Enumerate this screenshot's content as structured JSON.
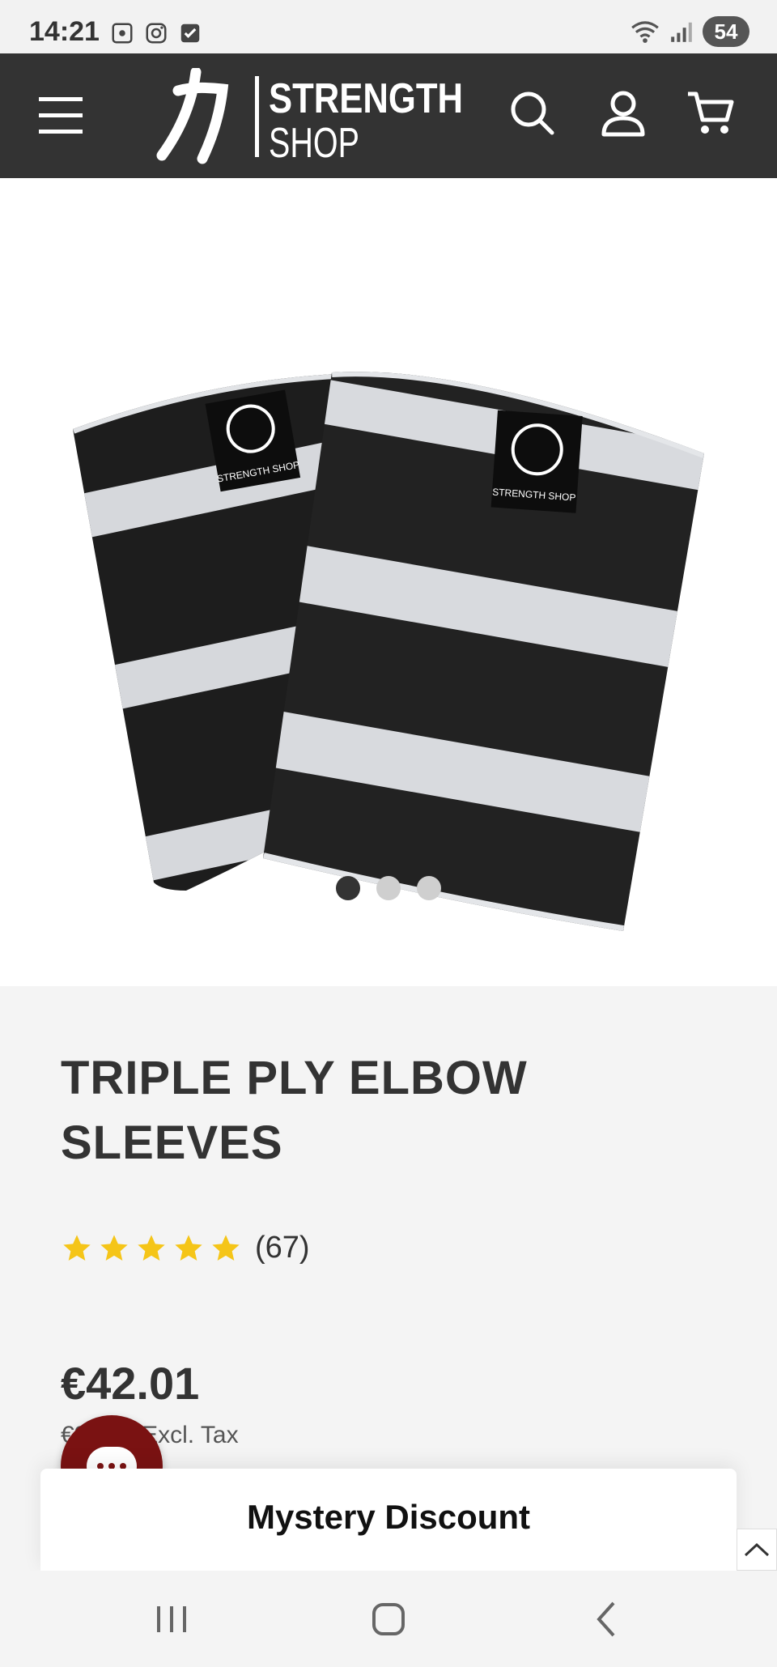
{
  "status_bar": {
    "time": "14:21",
    "battery": "54",
    "icons": [
      "screenshot-icon",
      "instagram-icon",
      "checkbox-icon",
      "wifi-icon",
      "signal-icon"
    ]
  },
  "header": {
    "brand_top": "STRENGTH",
    "brand_bottom": "SHOP",
    "icons": [
      "menu-icon",
      "search-icon",
      "account-icon",
      "cart-icon"
    ],
    "color": "#333333"
  },
  "gallery": {
    "image_alt": "Triple ply elbow sleeves product image",
    "label_text": "STRENGTH SHOP",
    "dot_count": 3,
    "active_index": 0
  },
  "product": {
    "title": "TRIPLE PLY ELBOW SLEEVES",
    "rating_stars": 5,
    "review_count": "(67)",
    "price": "€42.01",
    "excl_tax": "€34.72 Excl. Tax"
  },
  "popup": {
    "mystery_label": "Mystery Discount",
    "chat_color": "#7a1212",
    "star_color": "#f5c518"
  }
}
